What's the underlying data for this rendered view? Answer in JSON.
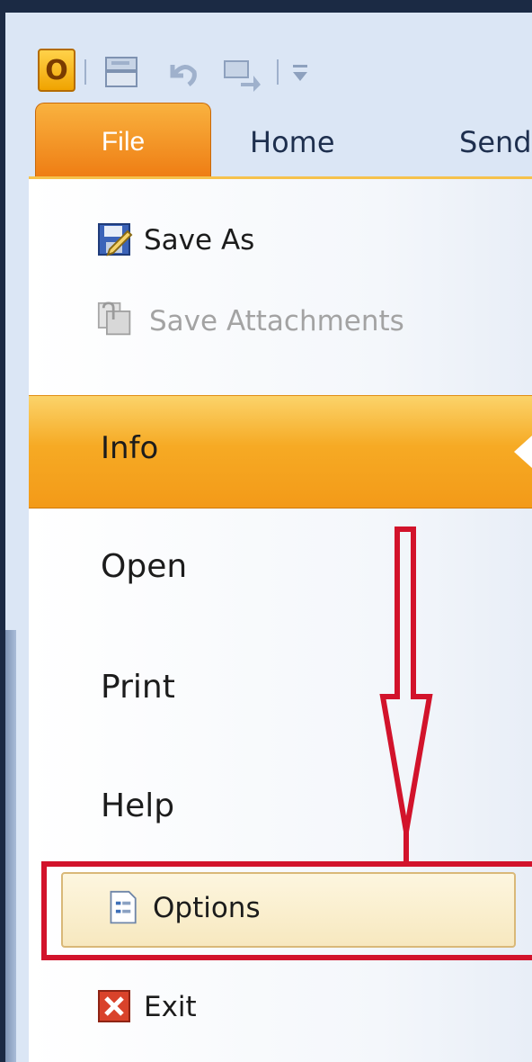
{
  "quick_access": {
    "logo_letter": "O",
    "icons": [
      "outlook-logo-icon",
      "send-receive-icon",
      "undo-icon",
      "reply-icon",
      "customize-icon"
    ]
  },
  "tabs": [
    {
      "label": "File",
      "active": true
    },
    {
      "label": "Home",
      "active": false
    },
    {
      "label": "Send",
      "active": false
    }
  ],
  "commands": [
    {
      "label": "Save As",
      "enabled": true,
      "icon": "save-as-icon"
    },
    {
      "label": "Save Attachments",
      "enabled": false,
      "icon": "save-attachments-icon"
    }
  ],
  "nav": [
    {
      "label": "Info",
      "selected": true
    },
    {
      "label": "Open",
      "selected": false
    },
    {
      "label": "Print",
      "selected": false
    },
    {
      "label": "Help",
      "selected": false
    }
  ],
  "options_command": {
    "label": "Options",
    "icon": "options-icon",
    "highlighted": true
  },
  "exit_command": {
    "label": "Exit",
    "icon": "exit-icon"
  },
  "annotation": {
    "color": "#d2132b"
  }
}
